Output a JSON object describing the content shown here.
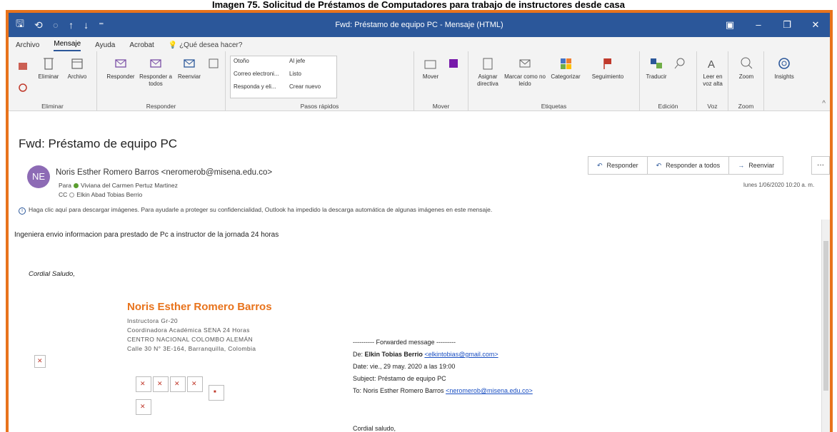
{
  "caption": "Imagen 75. Solicitud de Préstamos de Computadores para trabajo de instructores desde casa",
  "window": {
    "title": "Fwd: Préstamo de equipo PC  -  Mensaje (HTML)",
    "qat": [
      "⟲",
      "↑",
      "↓",
      "⁼"
    ]
  },
  "menu": {
    "items": [
      "Archivo",
      "Mensaje",
      "Ayuda",
      "Acrobat"
    ],
    "active": "Mensaje",
    "tell_me": "¿Qué desea hacer?"
  },
  "ribbon": {
    "eliminar": {
      "label": "Eliminar",
      "delete": "Eliminar",
      "archive": "Archivo"
    },
    "responder": {
      "label": "Responder",
      "reply": "Responder",
      "reply_all": "Responder a todos",
      "forward": "Reenviar"
    },
    "pasos": {
      "label": "Pasos rápidos",
      "items": [
        "Otoño",
        "Al jefe",
        "Correo electroni...",
        "Listo",
        "Responda y eli...",
        "Crear nuevo"
      ]
    },
    "mover": {
      "label": "Mover",
      "move": "Mover"
    },
    "etiquetas": {
      "label": "Etiquetas",
      "assign": "Asignar directiva",
      "mark": "Marcar como no leído",
      "categorize": "Categorizar",
      "follow": "Seguimiento"
    },
    "edicion": {
      "label": "Edición",
      "translate": "Traducir"
    },
    "voz": {
      "label": "Voz",
      "read": "Leer en voz alta"
    },
    "zoom": {
      "label": "Zoom",
      "zoom": "Zoom"
    },
    "insights": "Insights"
  },
  "message": {
    "subject": "Fwd: Préstamo de equipo PC",
    "avatar": "NE",
    "from": "Noris Esther Romero Barros <neromerob@misena.edu.co>",
    "to_label": "Para",
    "to": "Viviana del Carmen Pertuz Martinez",
    "cc_label": "CC",
    "cc": "Elkin Abad Tobias Berrio",
    "date": "lunes 1/06/2020 10:20 a. m.",
    "info": "Haga clic aquí para descargar imágenes. Para ayudarle a proteger su confidencialidad, Outlook ha impedido la descarga automática de algunas imágenes en este mensaje.",
    "actions": {
      "reply": "Responder",
      "reply_all": "Responder a todos",
      "forward": "Reenviar",
      "more": "···"
    }
  },
  "body": {
    "line1": "Ingeniera envio informacion para prestado de Pc a instructor de la jornada 24 horas",
    "cordial": "Cordial Saludo,",
    "signature": {
      "name": "Noris Esther Romero Barros",
      "lines": [
        "Instructora Gr-20",
        "Coordinadora Académica SENA 24 Horas",
        "CENTRO NACIONAL COLOMBO ALEMÁN",
        "Calle 30 N° 3E-164, Barranquilla, Colombia"
      ]
    },
    "forwarded": {
      "header": "---------- Forwarded message ---------",
      "de_label": "De:",
      "de_name": "Elkin Tobias Berrio",
      "de_email": "<elkintobias@gmail.com>",
      "date": "Date: vie., 29 may. 2020 a las 19:00",
      "subject": "Subject: Préstamo de equipo PC",
      "to_label": "To: Noris Esther Romero Barros",
      "to_email": "<neromerob@misena.edu.co>",
      "closing": "Cordial saludo,"
    }
  }
}
